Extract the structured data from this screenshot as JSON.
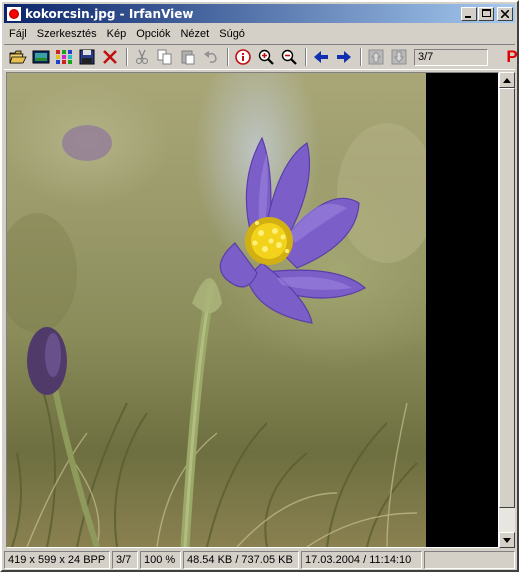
{
  "window": {
    "title": "kokorcsin.jpg - IrfanView"
  },
  "menu": {
    "items": [
      "Fájl",
      "Szerkesztés",
      "Kép",
      "Opciók",
      "Nézet",
      "Súgó"
    ]
  },
  "toolbar": {
    "icons": [
      "open-folder-icon",
      "slideshow-icon",
      "thumbnails-icon",
      "save-icon",
      "delete-icon",
      "cut-icon",
      "copy-icon",
      "paste-icon",
      "undo-icon",
      "info-icon",
      "zoom-in-icon",
      "zoom-out-icon",
      "previous-arrow-icon",
      "next-arrow-icon",
      "first-page-icon",
      "last-page-icon"
    ],
    "page_indicator": "3/7",
    "print_icon_glyph": "P"
  },
  "image": {
    "description_icon": "photo-flower-icon"
  },
  "statusbar": {
    "dimensions": "419 x 599 x 24 BPP",
    "index": "3/7",
    "zoom": "100 %",
    "size": "48.54 KB / 737.05 KB",
    "datetime": "17.03.2004 / 11:14:10"
  },
  "colors": {
    "titlebar_start": "#0a246a",
    "titlebar_end": "#a6caf0",
    "chrome": "#d4d0c8",
    "petal": "#7b5ec8",
    "stamen": "#f2d21a"
  }
}
